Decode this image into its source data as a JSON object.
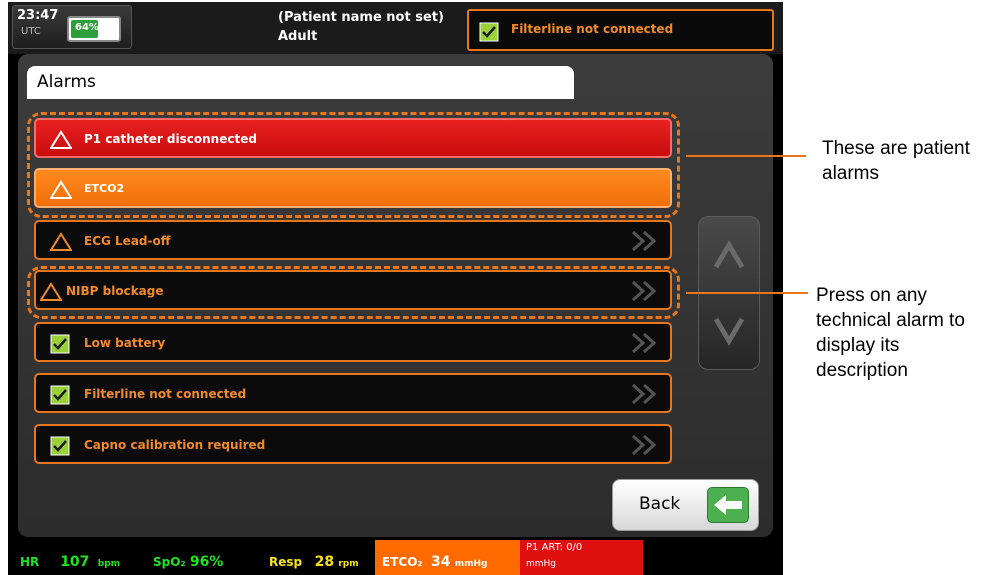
{
  "status_bar": {
    "time": "23:47",
    "utc_label": "UTC",
    "battery_percent": "64%",
    "battery_level": 0.64,
    "patient_name": "(Patient name not set)",
    "patient_type": "Adult",
    "active_alarm": "Filterline not connected"
  },
  "panel": {
    "title": "Alarms"
  },
  "alarms": [
    {
      "label": "P1 catheter disconnected",
      "kind": "patient",
      "color": "#d81010",
      "icon": "warning-triangle-icon"
    },
    {
      "label": "ETCO2",
      "kind": "patient",
      "color": "#f57a10",
      "icon": "warning-triangle-icon"
    },
    {
      "label": "ECG Lead-off",
      "kind": "technical",
      "icon": "warning-triangle-icon"
    },
    {
      "label": "NIBP blockage",
      "kind": "technical",
      "icon": "warning-triangle-icon"
    },
    {
      "label": "Low battery",
      "kind": "technical",
      "icon": "checkbox-icon"
    },
    {
      "label": "Filterline not connected",
      "kind": "technical",
      "icon": "checkbox-icon"
    },
    {
      "label": "Capno calibration required",
      "kind": "technical",
      "icon": "checkbox-icon"
    }
  ],
  "back_button": {
    "label": "Back"
  },
  "numerics": {
    "hr_label": "HR",
    "hr_value": "107",
    "hr_unit": "bpm",
    "spo2_label": "SpO₂",
    "spo2_value": "96%",
    "resp_label": "Resp",
    "resp_value": "28",
    "resp_unit": "rpm",
    "etco2_label": "ETCO₂",
    "etco2_value": "34",
    "etco2_unit": "mmHg",
    "p1_label": "P1 ART: 0/0",
    "p1_unit": "mmHg"
  },
  "annotations": {
    "patient_alarms": "These are patient alarms",
    "technical_alarms": "Press on any technical alarm to display its description"
  },
  "colors": {
    "accent": "#e8761b",
    "patient_red": "#d81010",
    "patient_orange": "#f57a10"
  }
}
